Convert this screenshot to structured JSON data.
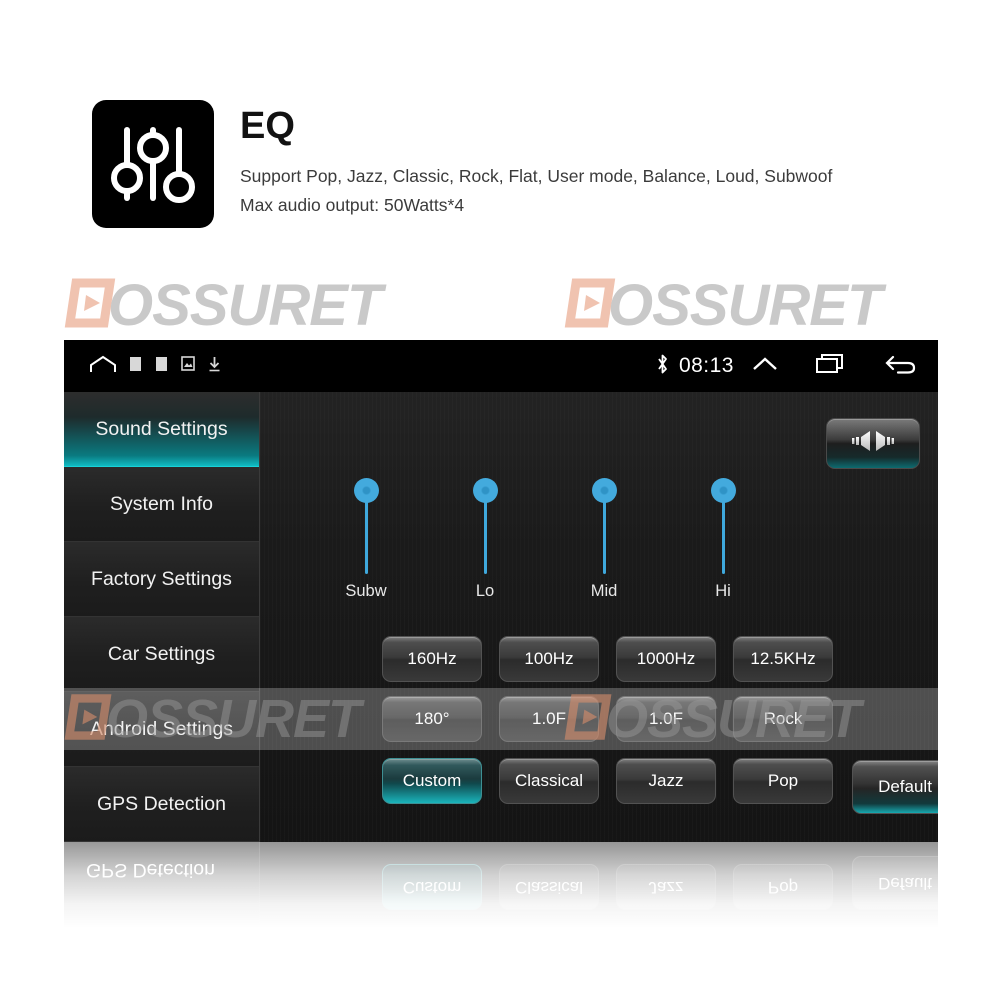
{
  "header": {
    "icon_name": "equalizer-sliders-icon",
    "title": "EQ",
    "line1": "Support Pop, Jazz, Classic, Rock, Flat, User mode, Balance, Loud, Subwoof",
    "line2": "Max audio output: 50Watts*4"
  },
  "watermark": {
    "text": "OSSURET",
    "logo_name": "play-button-logo",
    "logo_color": "#f0c3b0",
    "text_color": "#c9c9c9"
  },
  "device": {
    "statusbar": {
      "home_icon": "home-icon",
      "indicator_1": "status-square-icon",
      "indicator_2": "status-square-icon",
      "indicator_3": "image-icon",
      "download_icon": "download-icon",
      "bluetooth_icon": "bluetooth-icon",
      "clock": "08:13",
      "expand_icon": "chevron-up-icon",
      "recents_icon": "recent-apps-icon",
      "back_icon": "back-arrow-icon"
    },
    "sidebar": {
      "items": [
        {
          "label": "Sound Settings",
          "selected": true
        },
        {
          "label": "System Info",
          "selected": false
        },
        {
          "label": "Factory Settings",
          "selected": false
        },
        {
          "label": "Car Settings",
          "selected": false
        },
        {
          "label": "Android Settings",
          "selected": false
        },
        {
          "label": "GPS Detection",
          "selected": false
        }
      ]
    },
    "balance_button": {
      "name": "balance-fader-button",
      "icon_name": "dual-speaker-icon"
    },
    "sliders": [
      {
        "label": "Subw",
        "value": 100
      },
      {
        "label": "Lo",
        "value": 100
      },
      {
        "label": "Mid",
        "value": 100
      },
      {
        "label": "Hi",
        "value": 100
      }
    ],
    "row_frequency": [
      {
        "label": "160Hz",
        "selected": false
      },
      {
        "label": "100Hz",
        "selected": false
      },
      {
        "label": "1000Hz",
        "selected": false
      },
      {
        "label": "12.5KHz",
        "selected": false
      }
    ],
    "row_values": [
      {
        "label": "180°",
        "selected": false
      },
      {
        "label": "1.0F",
        "selected": false
      },
      {
        "label": "1.0F",
        "selected": false
      },
      {
        "label": "Rock",
        "selected": false
      }
    ],
    "row_presets": [
      {
        "label": "Custom",
        "selected": true
      },
      {
        "label": "Classical",
        "selected": false
      },
      {
        "label": "Jazz",
        "selected": false
      },
      {
        "label": "Pop",
        "selected": false
      }
    ],
    "default_button": {
      "label": "Default"
    }
  },
  "colors": {
    "accent_teal": "#16b9c0",
    "slider_blue": "#43aadd",
    "screen_bg": "#141414",
    "statusbar_bg": "#000000"
  }
}
